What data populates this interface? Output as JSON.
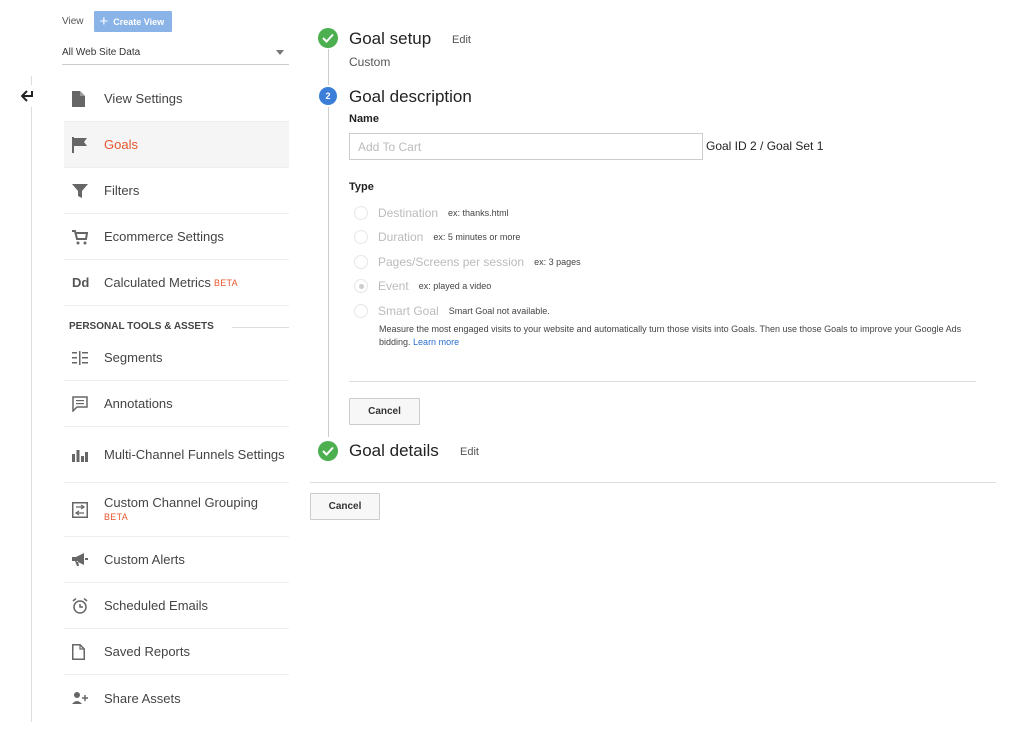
{
  "view": {
    "label": "View",
    "create_view_label": "Create View",
    "selected": "All Web Site Data"
  },
  "nav": {
    "items": [
      {
        "label": "View Settings",
        "icon": "document-icon"
      },
      {
        "label": "Goals",
        "icon": "flag-icon",
        "active": true
      },
      {
        "label": "Filters",
        "icon": "filter-icon"
      },
      {
        "label": "Ecommerce Settings",
        "icon": "cart-icon"
      },
      {
        "label": "Calculated Metrics",
        "badge": "BETA",
        "icon": "dd-icon"
      }
    ],
    "section_title": "PERSONAL TOOLS & ASSETS",
    "tools": [
      {
        "label": "Segments",
        "icon": "segments-icon"
      },
      {
        "label": "Annotations",
        "icon": "comment-icon"
      },
      {
        "label": "Multi-Channel Funnels Settings",
        "icon": "bar-chart-icon"
      },
      {
        "label": "Custom Channel Grouping",
        "badge": "BETA",
        "icon": "channel-grouping-icon"
      },
      {
        "label": "Custom Alerts",
        "icon": "megaphone-icon"
      },
      {
        "label": "Scheduled Emails",
        "icon": "alarm-clock-icon"
      },
      {
        "label": "Saved Reports",
        "icon": "saved-document-icon"
      },
      {
        "label": "Share Assets",
        "icon": "add-person-icon"
      }
    ],
    "dd_glyph": "Dd"
  },
  "goal_setup": {
    "title": "Goal setup",
    "edit": "Edit",
    "value": "Custom"
  },
  "goal_description": {
    "step_number": "2",
    "title": "Goal description",
    "name_label": "Name",
    "name_placeholder": "Add To Cart",
    "goal_id": "Goal ID 2 / Goal Set 1",
    "type_label": "Type",
    "types": [
      {
        "label": "Destination",
        "example": "ex: thanks.html",
        "checked": false
      },
      {
        "label": "Duration",
        "example": "ex: 5 minutes or more",
        "checked": false
      },
      {
        "label": "Pages/Screens per session",
        "example": "ex: 3 pages",
        "checked": false
      },
      {
        "label": "Event",
        "example": "ex: played a video",
        "checked": true
      },
      {
        "label": "Smart Goal",
        "example": "Smart Goal not available.",
        "checked": false
      }
    ],
    "smart_goal_desc": "Measure the most engaged visits to your website and automatically turn those visits into Goals. Then use those Goals to improve your Google Ads bidding.",
    "learn_more": "Learn more",
    "cancel": "Cancel"
  },
  "goal_details": {
    "title": "Goal details",
    "edit": "Edit"
  },
  "footer": {
    "cancel": "Cancel"
  },
  "colors": {
    "accent": "#e4572e",
    "step_done": "#4caf50",
    "step_active": "#3b7ed9",
    "create_view": "#8ab4e8",
    "link": "#2a6fcf"
  }
}
